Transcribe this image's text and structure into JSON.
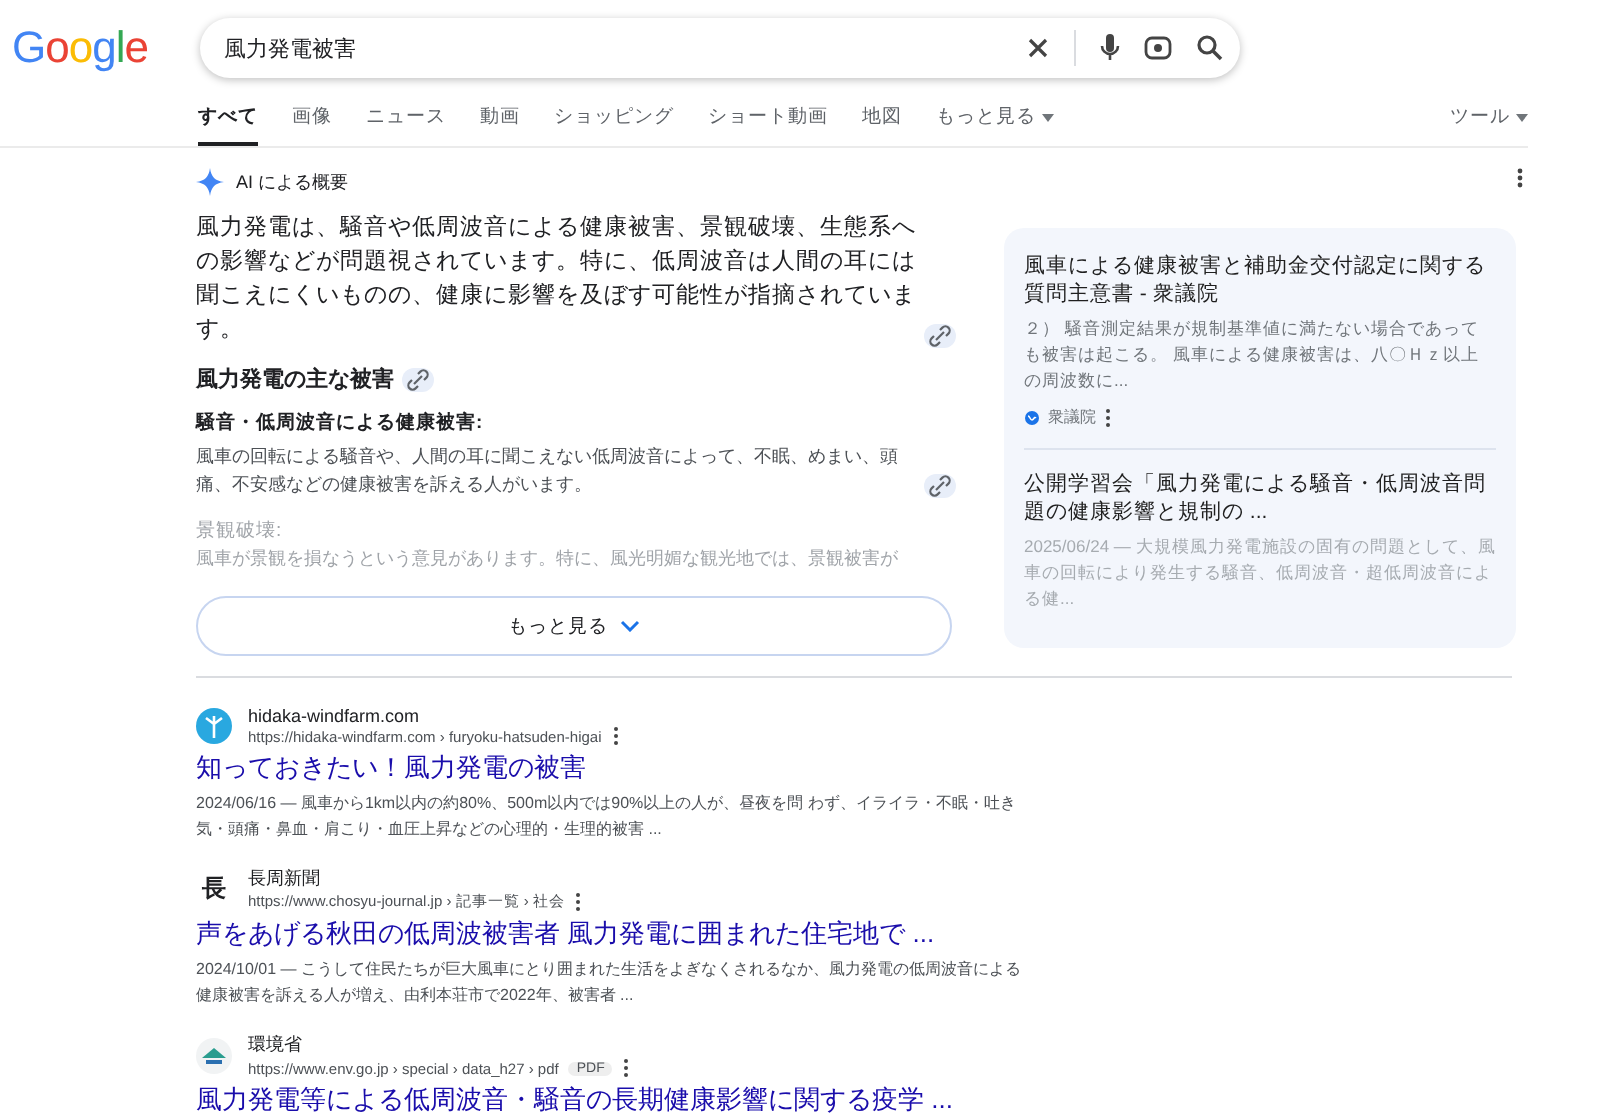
{
  "search": {
    "logo": "Google",
    "query": "風力発電被害"
  },
  "tabs": [
    {
      "label": "すべて",
      "selected": true,
      "kind": "tab"
    },
    {
      "label": "画像",
      "selected": false,
      "kind": "tab"
    },
    {
      "label": "ニュース",
      "selected": false,
      "kind": "tab"
    },
    {
      "label": "動画",
      "selected": false,
      "kind": "tab"
    },
    {
      "label": "ショッピング",
      "selected": false,
      "kind": "tab"
    },
    {
      "label": "ショート動画",
      "selected": false,
      "kind": "tab"
    },
    {
      "label": "地図",
      "selected": false,
      "kind": "tab"
    },
    {
      "label": "もっと見る",
      "selected": false,
      "kind": "menu"
    }
  ],
  "tools": "ツール",
  "ai_overview": {
    "title": "AI による概要",
    "summary": "風力発電は、騒音や低周波音による健康被害、景観破壊、生態系への影響などが問題視されています。特に、低周波音は人間の耳には聞こえにくいものの、健康に影響を及ぼす可能性が指摘されています。",
    "heading": "風力発電の主な被害",
    "points": [
      {
        "title": "騒音・低周波音による健康被害:",
        "text": "風車の回転による騒音や、人間の耳に聞こえない低周波音によって、不眠、めまい、頭痛、不安感などの健康被害を訴える人がいます。",
        "faded": false
      },
      {
        "title": "景観破壊:",
        "text": "風車が景観を損なうという意見があります。特に、風光明媚な観光地では、景観被害が",
        "faded": true
      }
    ],
    "more_button": "もっと見る",
    "sources": [
      {
        "title": "風車による健康被害と補助金交付認定に関する質問主意書 - 衆議院",
        "snippet": "２） 騒音測定結果が規制基準値に満たない場合であっても被害は起こる。 風車による健康被害は、八〇Ｈｚ以上の周波数に...",
        "site": "衆議院",
        "faded": false
      },
      {
        "title": "公開学習会「風力発電による騒音・低周波音問題の健康影響と規制の ...",
        "snippet": "2025/06/24 — 大規模風力発電施設の固有の問題として、風車の回転により発生する騒音、低周波音・超低周波音による健...",
        "faded": true
      }
    ]
  },
  "results": [
    {
      "site": "hidaka-windfarm.com",
      "url": "https://hidaka-windfarm.com › furyoku-hatsuden-higai",
      "title": "知っておきたい！風力発電の被害",
      "snippet": "2024/06/16 — 風車から1km以内の約80%、500m以内では90%以上の人が、昼夜を問 わず、イライラ・不眠・吐き気・頭痛・鼻血・肩こり・血圧上昇などの心理的・生理的被害 ..."
    },
    {
      "site": "長周新聞",
      "url": "https://www.chosyu-journal.jp › 記事一覧 › 社会",
      "title": "声をあげる秋田の低周波被害者 風力発電に囲まれた住宅地で ...",
      "snippet": "2024/10/01 — こうして住民たちが巨大風車にとり囲まれた生活をよぎなくされるなか、風力発電の低周波音による健康被害を訴える人が増え、由利本荘市で2022年、被害者 ...",
      "icon_text": "長"
    },
    {
      "site": "環境省",
      "url": "https://www.env.go.jp › special › data_h27 › pdf",
      "badge": "PDF",
      "title": "風力発電等による低周波音・騒音の長期健康影響に関する疫学 ..."
    }
  ]
}
